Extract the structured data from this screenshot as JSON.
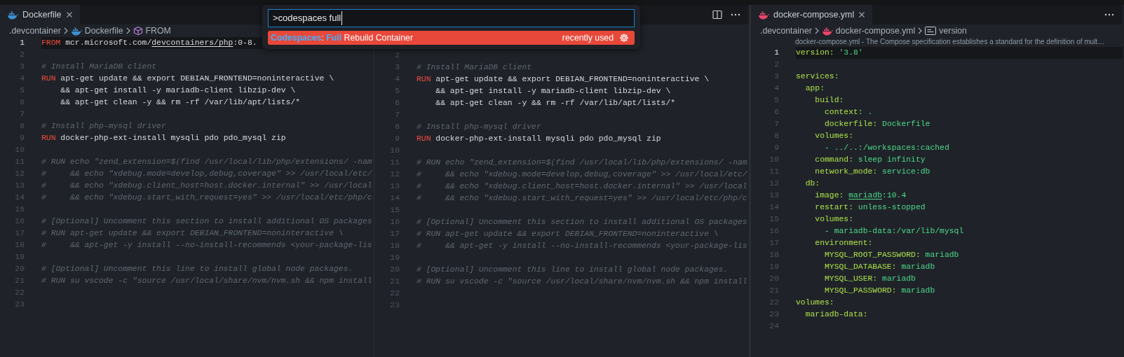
{
  "panes": [
    {
      "tab": {
        "label": "Dockerfile",
        "selected": true
      },
      "breadcrumbs": [
        {
          "label": ".devcontainer"
        },
        {
          "label": "Dockerfile"
        },
        {
          "label": "FROM"
        }
      ],
      "lines": [
        {
          "number": "1",
          "current": true,
          "tokens": [
            {
              "kind": "keyword",
              "text": "FROM"
            },
            {
              "kind": "plain",
              "text": " mcr.microsoft.com/"
            },
            {
              "kind": "link",
              "text": "devcontainers/php"
            },
            {
              "kind": "plain",
              "text": ":0-8."
            }
          ]
        },
        {
          "number": "2",
          "current": false
        },
        {
          "number": "3",
          "current": false,
          "tokens": [
            {
              "kind": "comment",
              "text": "# Install MariaDB client"
            }
          ]
        },
        {
          "number": "4",
          "current": false,
          "tokens": [
            {
              "kind": "keyword",
              "text": "RUN"
            },
            {
              "kind": "plain",
              "text": " apt-get update && export DEBIAN_FRONTEND=noninteractive \\"
            }
          ]
        },
        {
          "number": "5",
          "current": false,
          "tokens": [
            {
              "kind": "plain",
              "text": "    && apt-get install -y mariadb-client libzip-dev \\"
            }
          ]
        },
        {
          "number": "6",
          "current": false,
          "tokens": [
            {
              "kind": "plain",
              "text": "    && apt-get clean -y && rm -rf /var/lib/apt/lists/*"
            }
          ]
        },
        {
          "number": "7",
          "current": false
        },
        {
          "number": "8",
          "current": false,
          "tokens": [
            {
              "kind": "comment",
              "text": "# Install php-mysql driver"
            }
          ]
        },
        {
          "number": "9",
          "current": false,
          "tokens": [
            {
              "kind": "keyword",
              "text": "RUN"
            },
            {
              "kind": "plain",
              "text": " docker-php-ext-install mysqli pdo pdo_mysql zip"
            }
          ]
        },
        {
          "number": "10",
          "current": false
        },
        {
          "number": "11",
          "current": false,
          "tokens": [
            {
              "kind": "comment",
              "text": "# RUN echo \"zend_extension=$(find /usr/local/lib/php/extensions/ -nam"
            }
          ]
        },
        {
          "number": "12",
          "current": false,
          "tokens": [
            {
              "kind": "comment",
              "text": "#     && echo \"xdebug.mode=develop,debug,coverage\" >> /usr/local/etc/"
            }
          ]
        },
        {
          "number": "13",
          "current": false,
          "tokens": [
            {
              "kind": "comment",
              "text": "#     && echo \"xdebug.client_host=host.docker.internal\" >> /usr/local"
            }
          ]
        },
        {
          "number": "14",
          "current": false,
          "tokens": [
            {
              "kind": "comment",
              "text": "#     && echo \"xdebug.start_with_request=yes\" >> /usr/local/etc/php/c"
            }
          ]
        },
        {
          "number": "15",
          "current": false
        },
        {
          "number": "16",
          "current": false,
          "tokens": [
            {
              "kind": "comment",
              "text": "# [Optional] Uncomment this section to install additional OS packages"
            }
          ]
        },
        {
          "number": "17",
          "current": false,
          "tokens": [
            {
              "kind": "comment",
              "text": "# RUN apt-get update && export DEBIAN_FRONTEND=noninteractive \\"
            }
          ]
        },
        {
          "number": "18",
          "current": false,
          "tokens": [
            {
              "kind": "comment",
              "text": "#     && apt-get -y install --no-install-recommends <your-package-lis"
            }
          ]
        },
        {
          "number": "19",
          "current": false
        },
        {
          "number": "20",
          "current": false,
          "tokens": [
            {
              "kind": "comment",
              "text": "# [Optional] Uncomment this line to install global node packages."
            }
          ]
        },
        {
          "number": "21",
          "current": false,
          "tokens": [
            {
              "kind": "comment",
              "text": "# RUN su vscode -c \"source /usr/local/share/nvm/nvm.sh && npm install"
            }
          ]
        },
        {
          "number": "22",
          "current": false
        },
        {
          "number": "23",
          "current": false
        }
      ]
    },
    {
      "lines": [
        {
          "number": "2",
          "current": false
        },
        {
          "number": "3",
          "current": false,
          "tokens": [
            {
              "kind": "comment",
              "text": "# Install MariaDB client"
            }
          ]
        },
        {
          "number": "4",
          "current": false,
          "tokens": [
            {
              "kind": "keyword",
              "text": "RUN"
            },
            {
              "kind": "plain",
              "text": " apt-get update && export DEBIAN_FRONTEND=noninteractive \\"
            }
          ]
        },
        {
          "number": "5",
          "current": false,
          "tokens": [
            {
              "kind": "plain",
              "text": "    && apt-get install -y mariadb-client libzip-dev \\"
            }
          ]
        },
        {
          "number": "6",
          "current": false,
          "tokens": [
            {
              "kind": "plain",
              "text": "    && apt-get clean -y && rm -rf /var/lib/apt/lists/*"
            }
          ]
        },
        {
          "number": "7",
          "current": false
        },
        {
          "number": "8",
          "current": false,
          "tokens": [
            {
              "kind": "comment",
              "text": "# Install php-mysql driver"
            }
          ]
        },
        {
          "number": "9",
          "current": false,
          "tokens": [
            {
              "kind": "keyword",
              "text": "RUN"
            },
            {
              "kind": "plain",
              "text": " docker-php-ext-install mysqli pdo pdo_mysql zip"
            }
          ]
        },
        {
          "number": "10",
          "current": false
        },
        {
          "number": "11",
          "current": false,
          "tokens": [
            {
              "kind": "comment",
              "text": "# RUN echo \"zend_extension=$(find /usr/local/lib/php/extensions/ -nam"
            }
          ]
        },
        {
          "number": "12",
          "current": false,
          "tokens": [
            {
              "kind": "comment",
              "text": "#     && echo \"xdebug.mode=develop,debug,coverage\" >> /usr/local/etc/"
            }
          ]
        },
        {
          "number": "13",
          "current": false,
          "tokens": [
            {
              "kind": "comment",
              "text": "#     && echo \"xdebug.client_host=host.docker.internal\" >> /usr/local"
            }
          ]
        },
        {
          "number": "14",
          "current": false,
          "tokens": [
            {
              "kind": "comment",
              "text": "#     && echo \"xdebug.start_with_request=yes\" >> /usr/local/etc/php/c"
            }
          ]
        },
        {
          "number": "15",
          "current": false
        },
        {
          "number": "16",
          "current": false,
          "tokens": [
            {
              "kind": "comment",
              "text": "# [Optional] Uncomment this section to install additional OS packages"
            }
          ]
        },
        {
          "number": "17",
          "current": false,
          "tokens": [
            {
              "kind": "comment",
              "text": "# RUN apt-get update && export DEBIAN_FRONTEND=noninteractive \\"
            }
          ]
        },
        {
          "number": "18",
          "current": false,
          "tokens": [
            {
              "kind": "comment",
              "text": "#     && apt-get -y install --no-install-recommends <your-package-lis"
            }
          ]
        },
        {
          "number": "19",
          "current": false
        },
        {
          "number": "20",
          "current": false,
          "tokens": [
            {
              "kind": "comment",
              "text": "# [Optional] Uncomment this line to install global node packages."
            }
          ]
        },
        {
          "number": "21",
          "current": false,
          "tokens": [
            {
              "kind": "comment",
              "text": "# RUN su vscode -c \"source /usr/local/share/nvm/nvm.sh && npm install"
            }
          ]
        },
        {
          "number": "22",
          "current": false
        },
        {
          "number": "23",
          "current": false
        }
      ]
    },
    {
      "tab": {
        "label": "docker-compose.yml",
        "selected": true
      },
      "breadcrumbs": [
        {
          "label": ".devcontainer"
        },
        {
          "label": "docker-compose.yml"
        },
        {
          "label": "version"
        }
      ],
      "codelens": "docker-compose.yml - The Compose specification establishes a standard for the definition of mult…",
      "lines": [
        {
          "number": "1",
          "current": true,
          "tokens": [
            {
              "kind": "key",
              "text": "version:"
            },
            {
              "kind": "value",
              "text": " '3.8'"
            }
          ]
        },
        {
          "number": "2",
          "current": false
        },
        {
          "number": "3",
          "current": false,
          "tokens": [
            {
              "kind": "key",
              "text": "services:"
            }
          ]
        },
        {
          "number": "4",
          "current": false,
          "tokens": [
            {
              "kind": "key",
              "text": "  app:"
            }
          ]
        },
        {
          "number": "5",
          "current": false,
          "tokens": [
            {
              "kind": "key",
              "text": "    build:"
            }
          ]
        },
        {
          "number": "6",
          "current": false,
          "tokens": [
            {
              "kind": "key",
              "text": "      context:"
            },
            {
              "kind": "value",
              "text": " ."
            }
          ]
        },
        {
          "number": "7",
          "current": false,
          "tokens": [
            {
              "kind": "key",
              "text": "      dockerfile:"
            },
            {
              "kind": "value",
              "text": " Dockerfile"
            }
          ]
        },
        {
          "number": "8",
          "current": false,
          "tokens": [
            {
              "kind": "key",
              "text": "    volumes:"
            }
          ]
        },
        {
          "number": "9",
          "current": false,
          "tokens": [
            {
              "kind": "value",
              "text": "      - ../..:/workspaces:cached"
            }
          ]
        },
        {
          "number": "10",
          "current": false,
          "tokens": [
            {
              "kind": "key",
              "text": "    command:"
            },
            {
              "kind": "value",
              "text": " sleep infinity"
            }
          ]
        },
        {
          "number": "11",
          "current": false,
          "tokens": [
            {
              "kind": "key",
              "text": "    network_mode:"
            },
            {
              "kind": "value",
              "text": " service:db"
            }
          ]
        },
        {
          "number": "12",
          "current": false,
          "tokens": [
            {
              "kind": "key",
              "text": "  db:"
            }
          ]
        },
        {
          "number": "13",
          "current": false,
          "tokens": [
            {
              "kind": "key",
              "text": "    image: "
            },
            {
              "kind": "link",
              "text": "mariadb"
            },
            {
              "kind": "value",
              "text": ":10.4"
            }
          ]
        },
        {
          "number": "14",
          "current": false,
          "tokens": [
            {
              "kind": "key",
              "text": "    restart:"
            },
            {
              "kind": "value",
              "text": " unless-stopped"
            }
          ]
        },
        {
          "number": "15",
          "current": false,
          "tokens": [
            {
              "kind": "key",
              "text": "    volumes:"
            }
          ]
        },
        {
          "number": "16",
          "current": false,
          "tokens": [
            {
              "kind": "value",
              "text": "      - mariadb-data:/var/lib/mysql"
            }
          ]
        },
        {
          "number": "17",
          "current": false,
          "tokens": [
            {
              "kind": "key",
              "text": "    environment:"
            }
          ]
        },
        {
          "number": "18",
          "current": false,
          "tokens": [
            {
              "kind": "key",
              "text": "      MYSQL_ROOT_PASSWORD:"
            },
            {
              "kind": "value",
              "text": " mariadb"
            }
          ]
        },
        {
          "number": "19",
          "current": false,
          "tokens": [
            {
              "kind": "key",
              "text": "      MYSQL_DATABASE:"
            },
            {
              "kind": "value",
              "text": " mariadb"
            }
          ]
        },
        {
          "number": "20",
          "current": false,
          "tokens": [
            {
              "kind": "key",
              "text": "      MYSQL_USER:"
            },
            {
              "kind": "value",
              "text": " mariadb"
            }
          ]
        },
        {
          "number": "21",
          "current": false,
          "tokens": [
            {
              "kind": "key",
              "text": "      MYSQL_PASSWORD:"
            },
            {
              "kind": "value",
              "text": " mariadb"
            }
          ]
        },
        {
          "number": "22",
          "current": false,
          "tokens": [
            {
              "kind": "key",
              "text": "volumes:"
            }
          ]
        },
        {
          "number": "23",
          "current": false,
          "tokens": [
            {
              "kind": "key",
              "text": "  mariadb-data:"
            }
          ]
        },
        {
          "number": "24",
          "current": false
        }
      ]
    }
  ],
  "command_palette": {
    "query": ">codespaces full",
    "results": [
      {
        "selected": true,
        "segments": [
          {
            "text": "Codespaces",
            "match": true
          },
          {
            "text": ": ",
            "match": false
          },
          {
            "text": "Full",
            "match": true
          },
          {
            "text": " Rebuild Container",
            "match": false
          }
        ],
        "detail": "recently used"
      }
    ]
  }
}
